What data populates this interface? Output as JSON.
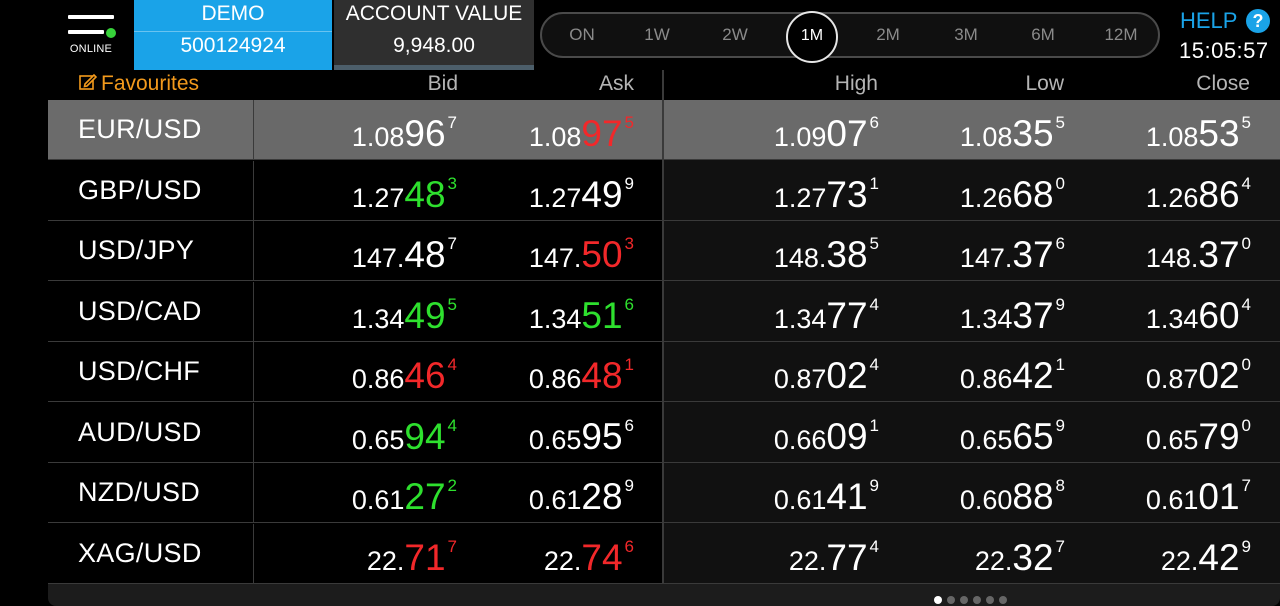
{
  "status": {
    "online_label": "ONLINE"
  },
  "account": {
    "mode_label": "DEMO",
    "account_id": "500124924",
    "value_label": "ACCOUNT VALUE",
    "value": "9,948.00"
  },
  "periods": {
    "items": [
      "ON",
      "1W",
      "2W",
      "1M",
      "2M",
      "3M",
      "6M",
      "12M"
    ],
    "active": "1M"
  },
  "help_label": "HELP",
  "help_icon": "question-icon",
  "clock": "15:05:57",
  "table": {
    "favourites_label": "Favourites",
    "favourites_icon": "edit-icon",
    "columns": {
      "bid": "Bid",
      "ask": "Ask",
      "high": "High",
      "low": "Low",
      "close": "Close"
    },
    "selected_symbol": "EUR/USD",
    "rows": [
      {
        "symbol": "EUR/USD",
        "bid": {
          "a": "1.08",
          "b": "96",
          "c": "7",
          "color": "white"
        },
        "ask": {
          "a": "1.08",
          "b": "97",
          "c": "5",
          "color": "red"
        },
        "high": {
          "a": "1.09",
          "b": "07",
          "c": "6"
        },
        "low": {
          "a": "1.08",
          "b": "35",
          "c": "5"
        },
        "close": {
          "a": "1.08",
          "b": "53",
          "c": "5"
        }
      },
      {
        "symbol": "GBP/USD",
        "bid": {
          "a": "1.27",
          "b": "48",
          "c": "3",
          "color": "green"
        },
        "ask": {
          "a": "1.27",
          "b": "49",
          "c": "9",
          "color": "white"
        },
        "high": {
          "a": "1.27",
          "b": "73",
          "c": "1"
        },
        "low": {
          "a": "1.26",
          "b": "68",
          "c": "0"
        },
        "close": {
          "a": "1.26",
          "b": "86",
          "c": "4"
        }
      },
      {
        "symbol": "USD/JPY",
        "bid": {
          "a": "147.",
          "b": "48",
          "c": "7",
          "color": "white"
        },
        "ask": {
          "a": "147.",
          "b": "50",
          "c": "3",
          "color": "red"
        },
        "high": {
          "a": "148.",
          "b": "38",
          "c": "5"
        },
        "low": {
          "a": "147.",
          "b": "37",
          "c": "6"
        },
        "close": {
          "a": "148.",
          "b": "37",
          "c": "0"
        }
      },
      {
        "symbol": "USD/CAD",
        "bid": {
          "a": "1.34",
          "b": "49",
          "c": "5",
          "color": "green"
        },
        "ask": {
          "a": "1.34",
          "b": "51",
          "c": "6",
          "color": "green"
        },
        "high": {
          "a": "1.34",
          "b": "77",
          "c": "4"
        },
        "low": {
          "a": "1.34",
          "b": "37",
          "c": "9"
        },
        "close": {
          "a": "1.34",
          "b": "60",
          "c": "4"
        }
      },
      {
        "symbol": "USD/CHF",
        "bid": {
          "a": "0.86",
          "b": "46",
          "c": "4",
          "color": "red"
        },
        "ask": {
          "a": "0.86",
          "b": "48",
          "c": "1",
          "color": "red"
        },
        "high": {
          "a": "0.87",
          "b": "02",
          "c": "4"
        },
        "low": {
          "a": "0.86",
          "b": "42",
          "c": "1"
        },
        "close": {
          "a": "0.87",
          "b": "02",
          "c": "0"
        }
      },
      {
        "symbol": "AUD/USD",
        "bid": {
          "a": "0.65",
          "b": "94",
          "c": "4",
          "color": "green"
        },
        "ask": {
          "a": "0.65",
          "b": "95",
          "c": "6",
          "color": "white"
        },
        "high": {
          "a": "0.66",
          "b": "09",
          "c": "1"
        },
        "low": {
          "a": "0.65",
          "b": "65",
          "c": "9"
        },
        "close": {
          "a": "0.65",
          "b": "79",
          "c": "0"
        }
      },
      {
        "symbol": "NZD/USD",
        "bid": {
          "a": "0.61",
          "b": "27",
          "c": "2",
          "color": "green"
        },
        "ask": {
          "a": "0.61",
          "b": "28",
          "c": "9",
          "color": "white"
        },
        "high": {
          "a": "0.61",
          "b": "41",
          "c": "9"
        },
        "low": {
          "a": "0.60",
          "b": "88",
          "c": "8"
        },
        "close": {
          "a": "0.61",
          "b": "01",
          "c": "7"
        }
      },
      {
        "symbol": "XAG/USD",
        "bid": {
          "a": "22.",
          "b": "71",
          "c": "7",
          "color": "red"
        },
        "ask": {
          "a": "22.",
          "b": "74",
          "c": "6",
          "color": "red"
        },
        "high": {
          "a": "22.",
          "b": "77",
          "c": "4"
        },
        "low": {
          "a": "22.",
          "b": "32",
          "c": "7"
        },
        "close": {
          "a": "22.",
          "b": "42",
          "c": "9"
        }
      }
    ]
  },
  "pager": {
    "count": 6,
    "active_index": 0
  },
  "colors": {
    "accent": "#1aa3e8",
    "favourites": "#f39a1c",
    "up": "#2ee02e",
    "down": "#f2282a",
    "online": "#37d23a"
  }
}
